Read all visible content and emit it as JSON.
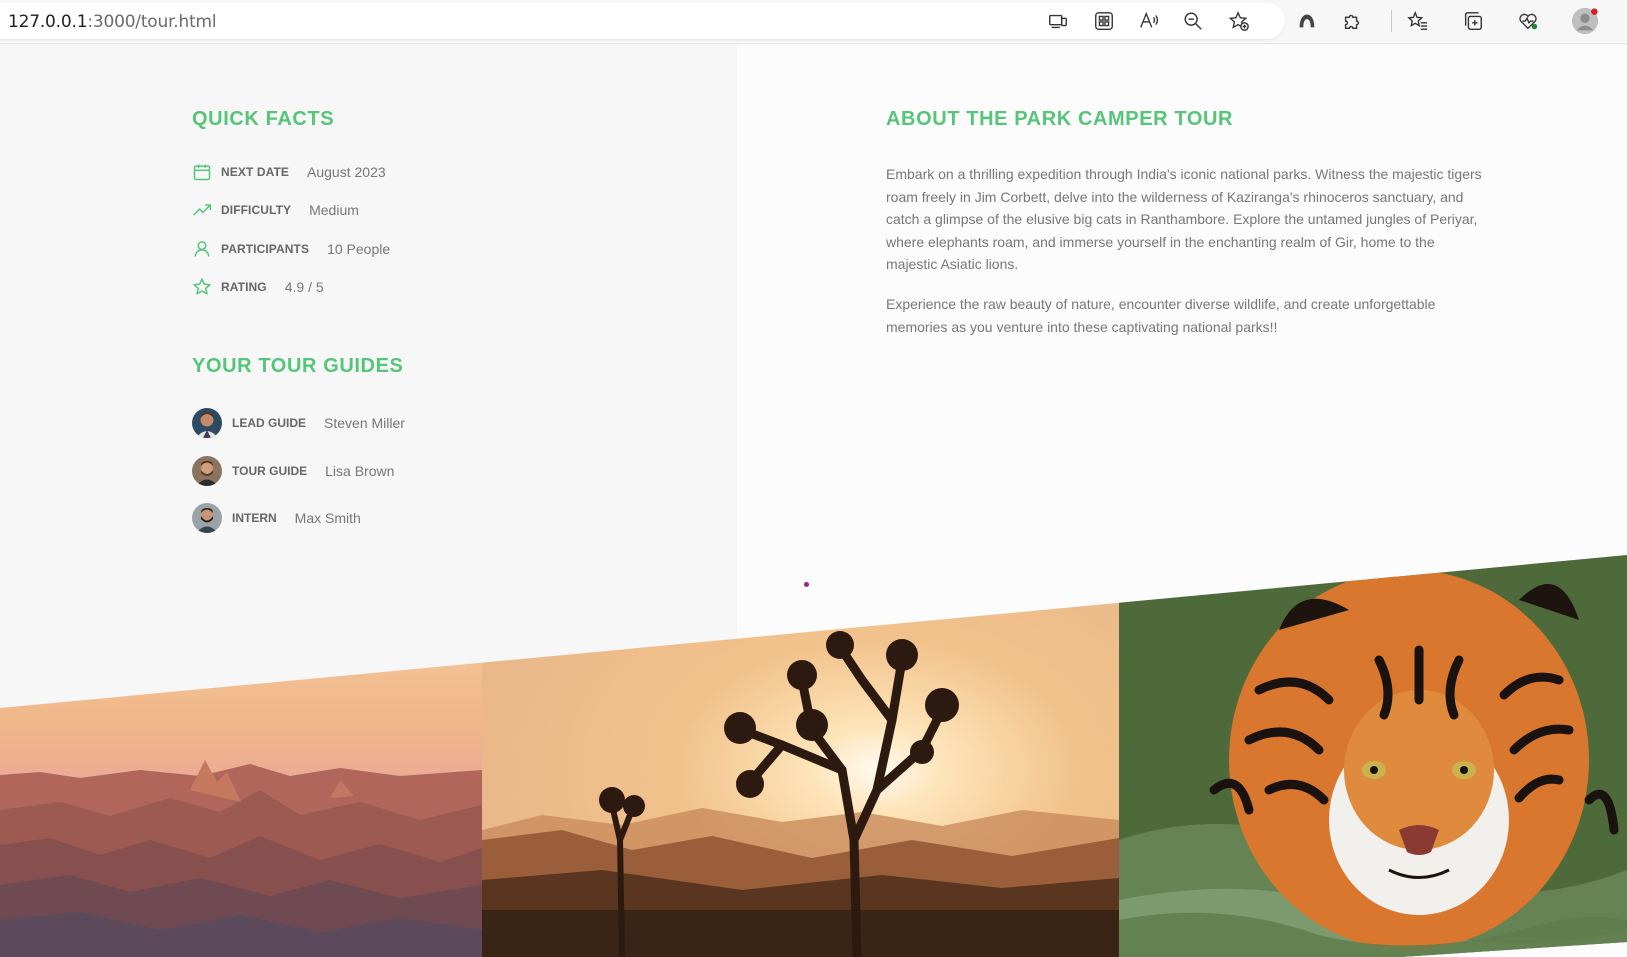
{
  "browser": {
    "url_host": "127.0.0.1",
    "url_rest": ":3000/tour.html",
    "toolbar_icons": [
      "device-icon",
      "apps-icon",
      "read-aloud-icon",
      "zoom-out-icon",
      "add-favorite-icon",
      "copilot-icon",
      "extensions-icon",
      "favorites-icon",
      "collections-icon",
      "browser-essentials-icon",
      "profile-icon"
    ]
  },
  "quick_facts": {
    "heading": "QUICK FACTS",
    "items": [
      {
        "icon": "calendar-icon",
        "label": "NEXT DATE",
        "value": "August 2023"
      },
      {
        "icon": "trending-up-icon",
        "label": "DIFFICULTY",
        "value": "Medium"
      },
      {
        "icon": "user-icon",
        "label": "PARTICIPANTS",
        "value": "10 People"
      },
      {
        "icon": "star-icon",
        "label": "RATING",
        "value": "4.9 / 5"
      }
    ]
  },
  "guides": {
    "heading": "YOUR TOUR GUIDES",
    "items": [
      {
        "label": "LEAD GUIDE",
        "name": "Steven Miller"
      },
      {
        "label": "TOUR GUIDE",
        "name": "Lisa Brown"
      },
      {
        "label": "INTERN",
        "name": "Max Smith"
      }
    ]
  },
  "about": {
    "heading": "ABOUT THE PARK CAMPER TOUR",
    "paragraphs": [
      "Embark on a thrilling expedition through India's iconic national parks. Witness the majestic tigers roam freely in Jim Corbett, delve into the wilderness of Kaziranga's rhinoceros sanctuary, and catch a glimpse of the elusive big cats in Ranthambore. Explore the untamed jungles of Periyar, where elephants roam, and immerse yourself in the enchanting realm of Gir, home to the majestic Asiatic lions.",
      "Experience the raw beauty of nature, encounter diverse wildlife, and create unforgettable memories as you venture into these captivating national parks!!"
    ]
  },
  "pictures": [
    "canyon-photo",
    "joshua-tree-sunset-photo",
    "tiger-photo"
  ],
  "colors": {
    "accent": "#55c57a",
    "text": "#777777"
  }
}
